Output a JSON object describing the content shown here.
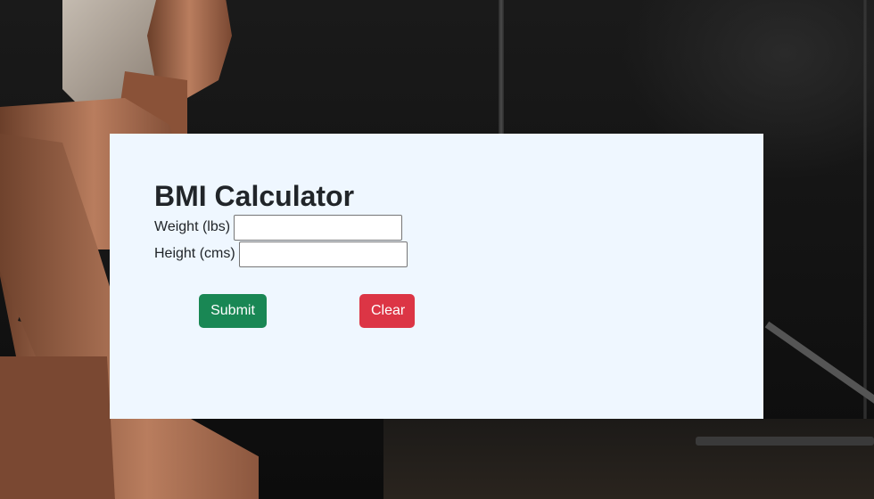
{
  "form": {
    "title": "BMI Calculator",
    "weight_label": "Weight (lbs)",
    "weight_value": "",
    "height_label": "Height (cms)",
    "height_value": ""
  },
  "buttons": {
    "submit_label": "Submit",
    "clear_label": "Clear"
  },
  "colors": {
    "card_background": "#eff7ff",
    "submit": "#198754",
    "clear": "#dc3545",
    "text": "#212529"
  }
}
